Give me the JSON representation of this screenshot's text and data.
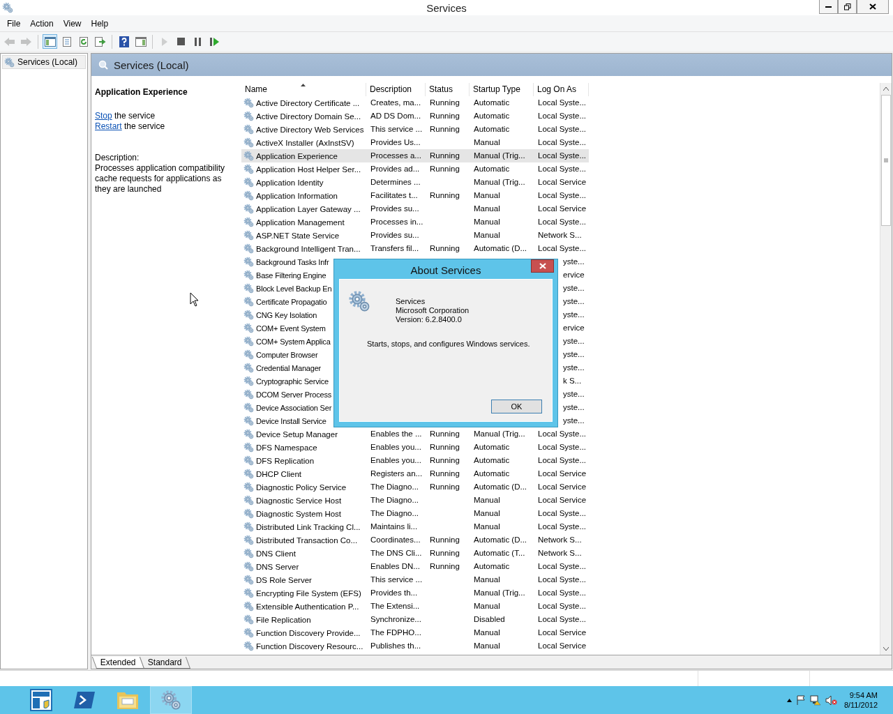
{
  "window": {
    "title": "Services"
  },
  "menu": [
    {
      "label": "File"
    },
    {
      "label": "Action"
    },
    {
      "label": "View"
    },
    {
      "label": "Help"
    }
  ],
  "toolbar": [
    {
      "kind": "back",
      "disabled": true,
      "selected": false
    },
    {
      "kind": "forward",
      "disabled": true,
      "selected": false
    },
    {
      "kind": "sep"
    },
    {
      "kind": "console_tree",
      "disabled": false,
      "selected": true
    },
    {
      "kind": "properties",
      "disabled": false,
      "selected": false
    },
    {
      "kind": "refresh",
      "disabled": false,
      "selected": false
    },
    {
      "kind": "export",
      "disabled": false,
      "selected": false
    },
    {
      "kind": "sep"
    },
    {
      "kind": "help",
      "disabled": false,
      "selected": false
    },
    {
      "kind": "action_pane",
      "disabled": false,
      "selected": false
    },
    {
      "kind": "sep"
    },
    {
      "kind": "start",
      "disabled": true,
      "selected": false
    },
    {
      "kind": "stop",
      "disabled": false,
      "selected": false
    },
    {
      "kind": "pause",
      "disabled": false,
      "selected": false
    },
    {
      "kind": "resume",
      "disabled": false,
      "selected": false
    }
  ],
  "tree": {
    "items": [
      {
        "label": "Services (Local)",
        "selected": true
      }
    ]
  },
  "pane": {
    "title": "Services (Local)"
  },
  "details": {
    "service_name": "Application Experience",
    "actions": [
      {
        "link": "Stop",
        "text": "the service"
      },
      {
        "link": "Restart",
        "text": "the service"
      }
    ],
    "description_label": "Description:",
    "description": "Processes application compatibility cache requests for applications as they are launched"
  },
  "table": {
    "columns": [
      {
        "label": "Name",
        "sorted": true
      },
      {
        "label": "Description",
        "sorted": false
      },
      {
        "label": "Status",
        "sorted": false
      },
      {
        "label": "Startup Type",
        "sorted": false
      },
      {
        "label": "Log On As",
        "sorted": false
      }
    ],
    "rows": [
      {
        "kind": "full",
        "name": "Active Directory Certificate ...",
        "description": "Creates, ma...",
        "status": "Running",
        "startup_type": "Automatic",
        "log_on_as": "Local Syste...",
        "selected": false
      },
      {
        "kind": "full",
        "name": "Active Directory Domain Se...",
        "description": "AD DS Dom...",
        "status": "Running",
        "startup_type": "Automatic",
        "log_on_as": "Local Syste...",
        "selected": false
      },
      {
        "kind": "full",
        "name": "Active Directory Web Services",
        "description": "This service ...",
        "status": "Running",
        "startup_type": "Automatic",
        "log_on_as": "Local Syste...",
        "selected": false
      },
      {
        "kind": "full",
        "name": "ActiveX Installer (AxInstSV)",
        "description": "Provides Us...",
        "startup_type": "Manual",
        "log_on_as": "Local Syste...",
        "selected": false
      },
      {
        "kind": "full",
        "name": "Application Experience",
        "description": "Processes a...",
        "status": "Running",
        "startup_type": "Manual (Trig...",
        "log_on_as": "Local Syste...",
        "selected": true
      },
      {
        "kind": "full",
        "name": "Application Host Helper Ser...",
        "description": "Provides ad...",
        "status": "Running",
        "startup_type": "Automatic",
        "log_on_as": "Local Syste...",
        "selected": false
      },
      {
        "kind": "full",
        "name": "Application Identity",
        "description": "Determines ...",
        "startup_type": "Manual (Trig...",
        "log_on_as": "Local Service",
        "selected": false
      },
      {
        "kind": "full",
        "name": "Application Information",
        "description": "Facilitates t...",
        "status": "Running",
        "startup_type": "Manual",
        "log_on_as": "Local Syste...",
        "selected": false
      },
      {
        "kind": "full",
        "name": "Application Layer Gateway ...",
        "description": "Provides su...",
        "startup_type": "Manual",
        "log_on_as": "Local Service",
        "selected": false
      },
      {
        "kind": "full",
        "name": "Application Management",
        "description": "Processes in...",
        "startup_type": "Manual",
        "log_on_as": "Local Syste...",
        "selected": false
      },
      {
        "kind": "full",
        "name": "ASP.NET State Service",
        "description": "Provides su...",
        "startup_type": "Manual",
        "log_on_as": "Network S...",
        "selected": false
      },
      {
        "kind": "full",
        "name": "Background Intelligent Tran...",
        "description": "Transfers fil...",
        "status": "Running",
        "startup_type": "Automatic (D...",
        "log_on_as": "Local Syste...",
        "selected": false
      },
      {
        "kind": "covered",
        "name": "Background Tasks Infr",
        "log_on_as": "yste...",
        "selected": false
      },
      {
        "kind": "covered",
        "name": "Base Filtering Engine",
        "log_on_as": "ervice",
        "selected": false
      },
      {
        "kind": "covered",
        "name": "Block Level Backup En",
        "log_on_as": "yste...",
        "selected": false
      },
      {
        "kind": "covered",
        "name": "Certificate Propagatio",
        "log_on_as": "yste...",
        "selected": false
      },
      {
        "kind": "covered",
        "name": "CNG Key Isolation",
        "log_on_as": "yste...",
        "selected": false
      },
      {
        "kind": "covered",
        "name": "COM+ Event System",
        "log_on_as": "ervice",
        "selected": false
      },
      {
        "kind": "covered",
        "name": "COM+ System Applica",
        "log_on_as": "yste...",
        "selected": false
      },
      {
        "kind": "covered",
        "name": "Computer Browser",
        "log_on_as": "yste...",
        "selected": false
      },
      {
        "kind": "covered",
        "name": "Credential Manager",
        "log_on_as": "yste...",
        "selected": false
      },
      {
        "kind": "covered",
        "name": "Cryptographic Service",
        "log_on_as": "k S...",
        "selected": false
      },
      {
        "kind": "covered",
        "name": "DCOM Server Process",
        "log_on_as": "yste...",
        "selected": false
      },
      {
        "kind": "covered",
        "name": "Device Association Ser",
        "log_on_as": "yste...",
        "selected": false
      },
      {
        "kind": "covered",
        "name": "Device Install Service",
        "log_on_as": "yste...",
        "selected": false
      },
      {
        "kind": "full",
        "name": "Device Setup Manager",
        "description": "Enables the ...",
        "status": "Running",
        "startup_type": "Manual (Trig...",
        "log_on_as": "Local Syste...",
        "selected": false
      },
      {
        "kind": "full",
        "name": "DFS Namespace",
        "description": "Enables you...",
        "status": "Running",
        "startup_type": "Automatic",
        "log_on_as": "Local Syste...",
        "selected": false
      },
      {
        "kind": "full",
        "name": "DFS Replication",
        "description": "Enables you...",
        "status": "Running",
        "startup_type": "Automatic",
        "log_on_as": "Local Syste...",
        "selected": false
      },
      {
        "kind": "full",
        "name": "DHCP Client",
        "description": "Registers an...",
        "status": "Running",
        "startup_type": "Automatic",
        "log_on_as": "Local Service",
        "selected": false
      },
      {
        "kind": "full",
        "name": "Diagnostic Policy Service",
        "description": "The Diagno...",
        "status": "Running",
        "startup_type": "Automatic (D...",
        "log_on_as": "Local Service",
        "selected": false
      },
      {
        "kind": "full",
        "name": "Diagnostic Service Host",
        "description": "The Diagno...",
        "startup_type": "Manual",
        "log_on_as": "Local Service",
        "selected": false
      },
      {
        "kind": "full",
        "name": "Diagnostic System Host",
        "description": "The Diagno...",
        "startup_type": "Manual",
        "log_on_as": "Local Syste...",
        "selected": false
      },
      {
        "kind": "full",
        "name": "Distributed Link Tracking Cl...",
        "description": "Maintains li...",
        "startup_type": "Manual",
        "log_on_as": "Local Syste...",
        "selected": false
      },
      {
        "kind": "full",
        "name": "Distributed Transaction Co...",
        "description": "Coordinates...",
        "status": "Running",
        "startup_type": "Automatic (D...",
        "log_on_as": "Network S...",
        "selected": false
      },
      {
        "kind": "full",
        "name": "DNS Client",
        "description": "The DNS Cli...",
        "status": "Running",
        "startup_type": "Automatic (T...",
        "log_on_as": "Network S...",
        "selected": false
      },
      {
        "kind": "full",
        "name": "DNS Server",
        "description": "Enables DN...",
        "status": "Running",
        "startup_type": "Automatic",
        "log_on_as": "Local Syste...",
        "selected": false
      },
      {
        "kind": "full",
        "name": "DS Role Server",
        "description": "This service ...",
        "startup_type": "Manual",
        "log_on_as": "Local Syste...",
        "selected": false
      },
      {
        "kind": "full",
        "name": "Encrypting File System (EFS)",
        "description": "Provides th...",
        "startup_type": "Manual (Trig...",
        "log_on_as": "Local Syste...",
        "selected": false
      },
      {
        "kind": "full",
        "name": "Extensible Authentication P...",
        "description": "The Extensi...",
        "startup_type": "Manual",
        "log_on_as": "Local Syste...",
        "selected": false
      },
      {
        "kind": "full",
        "name": "File Replication",
        "description": "Synchronize...",
        "startup_type": "Disabled",
        "log_on_as": "Local Syste...",
        "selected": false
      },
      {
        "kind": "full",
        "name": "Function Discovery Provide...",
        "description": "The FDPHO...",
        "startup_type": "Manual",
        "log_on_as": "Local Service",
        "selected": false
      },
      {
        "kind": "full",
        "name": "Function Discovery Resourc...",
        "description": "Publishes th...",
        "startup_type": "Manual",
        "log_on_as": "Local Service",
        "selected": false
      }
    ]
  },
  "view_tabs": [
    {
      "label": "Extended",
      "selected": true
    },
    {
      "label": "Standard",
      "selected": false
    }
  ],
  "dialog": {
    "title": "About Services",
    "product": "Services",
    "company": "Microsoft Corporation",
    "version": "Version: 6.2.8400.0",
    "summary": "Starts, stops, and configures Windows services.",
    "buttons": [
      "OK"
    ]
  },
  "taskbar": {
    "apps": [
      {
        "kind": "server_manager",
        "active": false
      },
      {
        "kind": "powershell",
        "active": false
      },
      {
        "kind": "explorer",
        "active": false
      },
      {
        "kind": "services",
        "active": true
      }
    ],
    "clock": {
      "time": "9:54 AM",
      "date": "8/11/2012"
    }
  }
}
